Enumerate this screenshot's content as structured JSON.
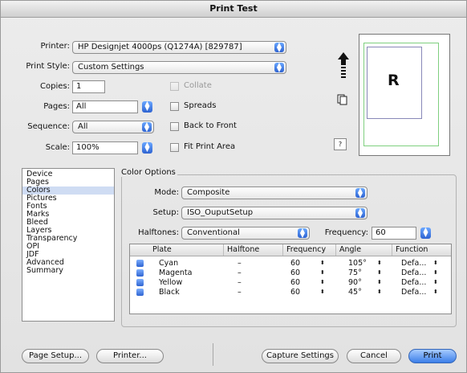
{
  "window": {
    "title": "Print Test"
  },
  "printer": {
    "label": "Printer:",
    "value": "HP Designjet 4000ps (Q1274A) [829787]"
  },
  "print_style": {
    "label": "Print Style:",
    "value": "Custom Settings"
  },
  "copies": {
    "label": "Copies:",
    "value": "1"
  },
  "pages": {
    "label": "Pages:",
    "value": "All"
  },
  "sequence": {
    "label": "Sequence:",
    "value": "All"
  },
  "scale": {
    "label": "Scale:",
    "value": "100%"
  },
  "options": {
    "collate": {
      "label": "Collate",
      "checked": false,
      "enabled": false
    },
    "spreads": {
      "label": "Spreads",
      "checked": false,
      "enabled": true
    },
    "back_to_front": {
      "label": "Back to Front",
      "checked": false,
      "enabled": true
    },
    "fit_print_area": {
      "label": "Fit Print Area",
      "checked": false,
      "enabled": true
    }
  },
  "preview": {
    "letter": "R",
    "help": "?"
  },
  "panels": [
    "Device",
    "Pages",
    "Colors",
    "Pictures",
    "Fonts",
    "Marks",
    "Bleed",
    "Layers",
    "Transparency",
    "OPI",
    "JDF",
    "Advanced",
    "Summary"
  ],
  "selected_panel": "Colors",
  "color_options": {
    "title": "Color Options",
    "mode": {
      "label": "Mode:",
      "value": "Composite"
    },
    "setup": {
      "label": "Setup:",
      "value": "ISO_OuputSetup"
    },
    "halftones": {
      "label": "Halftones:",
      "value": "Conventional"
    },
    "frequency": {
      "label": "Frequency:",
      "value": "60"
    },
    "table": {
      "headers": [
        "Plate",
        "Halftone",
        "Frequency",
        "Angle",
        "Function"
      ],
      "rows": [
        {
          "plate": "Cyan",
          "halftone": "–",
          "frequency": "60",
          "angle": "105°",
          "function": "Defa..."
        },
        {
          "plate": "Magenta",
          "halftone": "–",
          "frequency": "60",
          "angle": "75°",
          "function": "Defa..."
        },
        {
          "plate": "Yellow",
          "halftone": "–",
          "frequency": "60",
          "angle": "90°",
          "function": "Defa..."
        },
        {
          "plate": "Black",
          "halftone": "–",
          "frequency": "60",
          "angle": "45°",
          "function": "Defa..."
        }
      ]
    }
  },
  "buttons": {
    "page_setup": "Page Setup...",
    "printer": "Printer...",
    "capture_settings": "Capture Settings",
    "cancel": "Cancel",
    "print": "Print"
  },
  "colors": {
    "accent": "#3b7ee8",
    "selection": "#cfdcf3"
  }
}
